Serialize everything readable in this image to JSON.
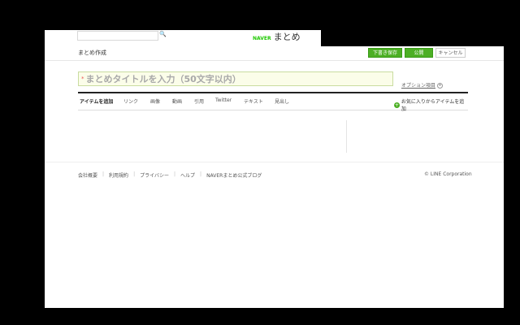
{
  "header": {
    "search": {
      "placeholder": ""
    },
    "logo_brand": "NAVER",
    "logo_word": "まとめ"
  },
  "toolbar": {
    "page_title": "まとめ作成",
    "draft_label": "下書き保存",
    "publish_label": "公開",
    "cancel_label": "キャンセル"
  },
  "editor": {
    "title_placeholder": "まとめタイトルを入力（50文字以内）",
    "required_mark": "*",
    "options_label": "オプション項目",
    "options_icon": "+"
  },
  "tabs": {
    "add_label": "アイテムを追加",
    "items": [
      "リンク",
      "画像",
      "動画",
      "引用",
      "Twitter",
      "テキスト",
      "見出し"
    ],
    "favorites_label": "お気に入りからアイテムを追加",
    "favorites_icon": "+"
  },
  "footer": {
    "links": [
      "会社概要",
      "利用規約",
      "プライバシー",
      "ヘルプ",
      "NAVERまとめ公式ブログ"
    ],
    "separator": "|",
    "copyright": "© LINE Corporation"
  },
  "colors": {
    "accent_green": "#4caf24",
    "input_bg": "#fbfde9",
    "input_border": "#c9dca0"
  }
}
